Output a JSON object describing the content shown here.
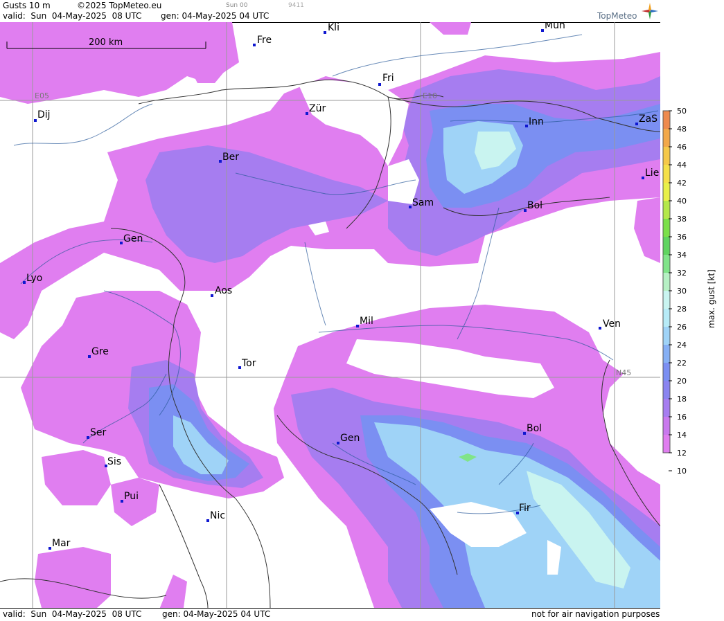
{
  "header": {
    "title": "Gusts 10 m",
    "copyright": "©2025 TopMeteo.eu",
    "run": "Sun 00",
    "code": "9411",
    "valid": "valid:  Sun  04-May-2025  08 UTC",
    "gen": "gen: 04-May-2025 04 UTC",
    "logo": "TopMeteo"
  },
  "footer": {
    "valid": "valid:  Sun  04-May-2025  08 UTC",
    "gen": "gen: 04-May-2025 04 UTC",
    "disclaimer": "not for air navigation purposes"
  },
  "scale": {
    "label": "200 km"
  },
  "grid": {
    "e05": "E05",
    "e10": "E10",
    "n45": "N45"
  },
  "cities": [
    {
      "name": "Kli"
    },
    {
      "name": "Mun"
    },
    {
      "name": "Fre"
    },
    {
      "name": "Fri"
    },
    {
      "name": "Dij"
    },
    {
      "name": "Zür"
    },
    {
      "name": "Inn"
    },
    {
      "name": "ZaS"
    },
    {
      "name": "Ber"
    },
    {
      "name": "Lie"
    },
    {
      "name": "Sam"
    },
    {
      "name": "Bol"
    },
    {
      "name": "Gen"
    },
    {
      "name": "Lyo"
    },
    {
      "name": "Aos"
    },
    {
      "name": "Mil"
    },
    {
      "name": "Ven"
    },
    {
      "name": "Gre"
    },
    {
      "name": "Tor"
    },
    {
      "name": "Ser"
    },
    {
      "name": "Gen"
    },
    {
      "name": "Bol"
    },
    {
      "name": "Sis"
    },
    {
      "name": "Pui"
    },
    {
      "name": "Fir"
    },
    {
      "name": "Nic"
    },
    {
      "name": "Mar"
    }
  ],
  "legend": {
    "title": "max. gust [kt]",
    "colors": {
      "12": "#e07ef0",
      "14": "#c979ee",
      "16": "#a67df0",
      "18": "#8a84f0",
      "20": "#7b8ff2",
      "22": "#86b0f5",
      "24": "#9fd3f7",
      "26": "#b7ebf7",
      "28": "#c9f4f0",
      "30": "#b6f0c4",
      "32": "#80e489",
      "34": "#5fd460",
      "36": "#7be04a",
      "38": "#b4e84a",
      "40": "#e8f04a",
      "42": "#f5e04a",
      "44": "#f5c84a",
      "46": "#f2a84a",
      "48": "#ee8a4e",
      "50": "#e8645a"
    },
    "ticks": [
      "50",
      "48",
      "46",
      "44",
      "42",
      "40",
      "38",
      "36",
      "34",
      "32",
      "30",
      "28",
      "26",
      "24",
      "22",
      "20",
      "18",
      "16",
      "14",
      "12",
      "10"
    ]
  }
}
